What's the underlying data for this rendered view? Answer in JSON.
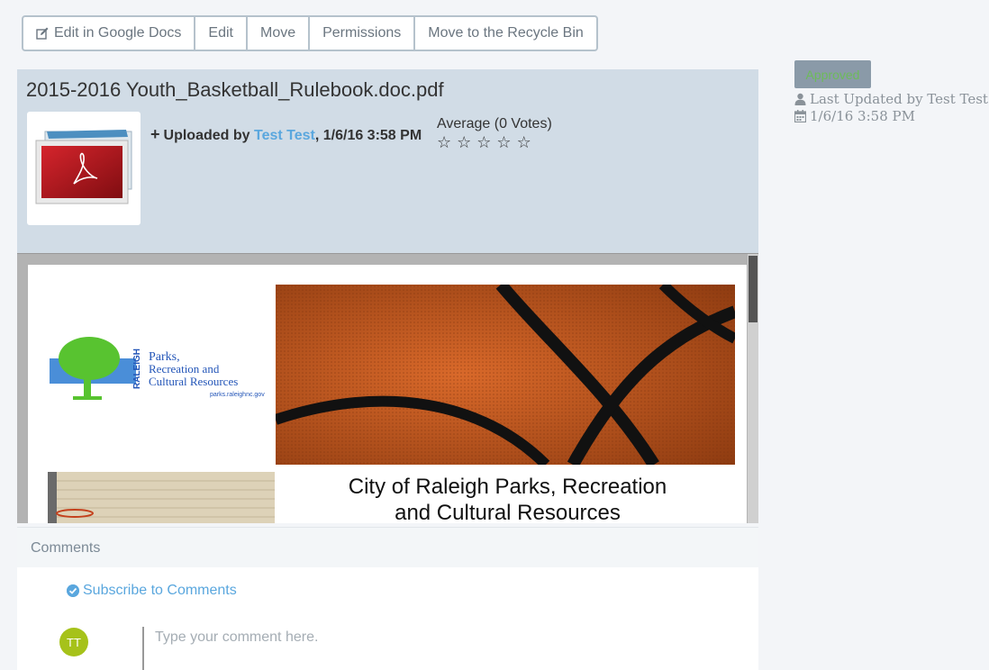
{
  "toolbar": {
    "edit_in_google_docs": "Edit in Google Docs",
    "edit": "Edit",
    "move": "Move",
    "permissions": "Permissions",
    "recycle": "Move to the Recycle Bin"
  },
  "document": {
    "title": "2015-2016 Youth_Basketball_Rulebook.doc.pdf",
    "uploaded_prefix": "Uploaded by",
    "uploader": "Test Test",
    "uploaded_date": ", 1/6/16 3:58 PM",
    "rating_label": "Average (0 Votes)",
    "rating_value": 0,
    "rating_max": 5
  },
  "preview": {
    "logo_lines": [
      "Parks,",
      "Recreation and",
      "Cultural Resources",
      "parks.raleighnc.gov"
    ],
    "logo_vertical": "RALEIGH",
    "heading_line1": "City of Raleigh Parks, Recreation",
    "heading_line2": "and Cultural Resources"
  },
  "comments": {
    "header": "Comments",
    "subscribe": "Subscribe to Comments",
    "avatar_initials": "TT",
    "placeholder": "Type your comment here."
  },
  "sidebar": {
    "status": "Approved",
    "last_updated": "Last Updated by Test Test",
    "date": "1/6/16 3:58 PM"
  },
  "colors": {
    "accent_link": "#5aa7de",
    "panel_bg": "#d1dce6",
    "avatar_bg": "#a6c21a",
    "status_text": "#6dbb5a"
  }
}
